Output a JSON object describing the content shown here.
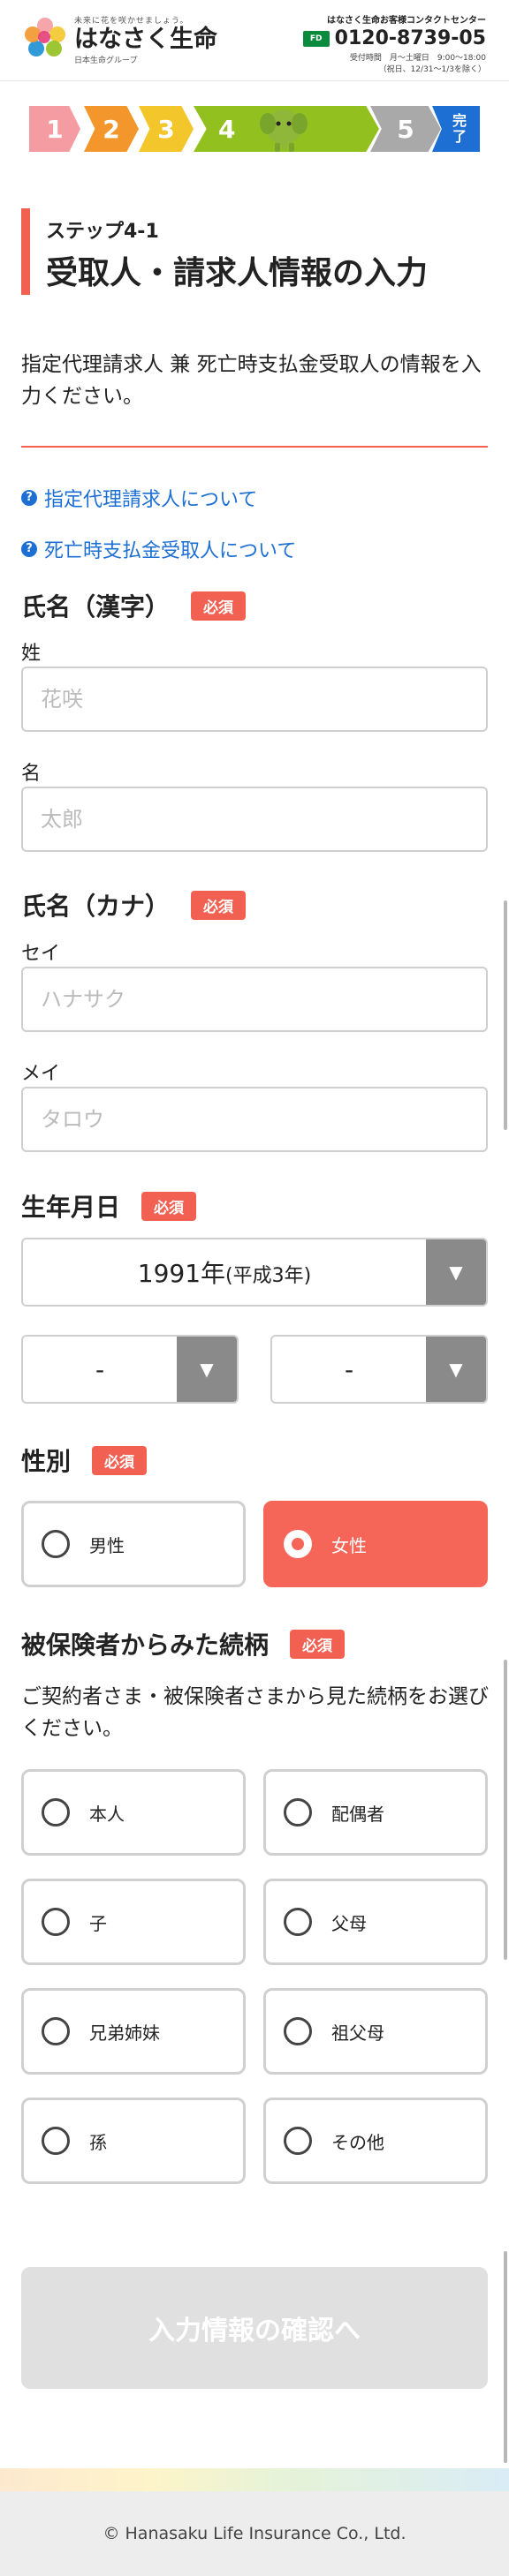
{
  "header": {
    "tagline": "未来に花を咲かせましょう。",
    "brand": "はなさく生命",
    "group": "日本生命グループ",
    "contact_title": "はなさく生命お客様コンタクトセンター",
    "freedial_label": "FD",
    "phone": "0120-8739-05",
    "hours": "受付時間　月〜土曜日　9:00〜18:00",
    "hours_note": "（祝日、12/31〜1/3を除く）"
  },
  "steps": {
    "s1": "1",
    "s2": "2",
    "s3": "3",
    "s4": "4",
    "s5": "5",
    "done_line1": "完",
    "done_line2": "了",
    "current": 4
  },
  "heading": {
    "sub": "ステップ4-1",
    "main": "受取人・請求人情報の入力"
  },
  "intro": "指定代理請求人 兼 死亡時支払金受取人の情報を入力ください。",
  "help_links": [
    "指定代理請求人について",
    "死亡時支払金受取人について"
  ],
  "required_badge": "必須",
  "name_kanji": {
    "label": "氏名（漢字）",
    "last_label": "姓",
    "last_placeholder": "花咲",
    "first_label": "名",
    "first_placeholder": "太郎"
  },
  "name_kana": {
    "label": "氏名（カナ）",
    "last_label": "セイ",
    "last_placeholder": "ハナサク",
    "first_label": "メイ",
    "first_placeholder": "タロウ"
  },
  "birthdate": {
    "label": "生年月日",
    "year_value": "1991年",
    "year_era": "(平成3年)",
    "month_value": "-",
    "day_value": "-"
  },
  "gender": {
    "label": "性別",
    "options": [
      "男性",
      "女性"
    ],
    "selected": "女性"
  },
  "relationship": {
    "label": "被保険者からみた続柄",
    "description": "ご契約者さま・被保険者さまから見た続柄をお選びください。",
    "options": [
      "本人",
      "配偶者",
      "子",
      "父母",
      "兄弟姉妹",
      "祖父母",
      "孫",
      "その他"
    ]
  },
  "submit_label": "入力情報の確認へ",
  "footer": "© Hanasaku Life Insurance Co., Ltd.",
  "colors": {
    "accent": "#f26052",
    "link": "#1d6fd4",
    "step_current": "#92c01f"
  }
}
